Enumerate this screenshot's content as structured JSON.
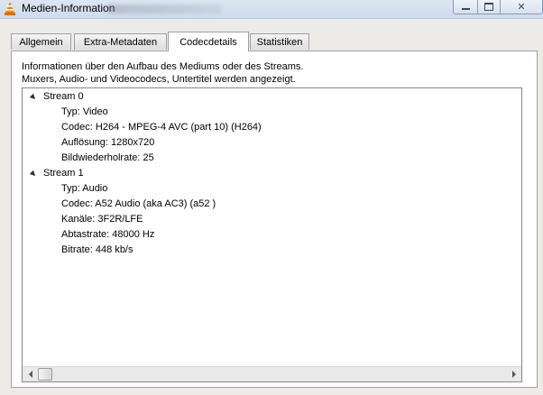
{
  "window": {
    "title": "Medien-Information",
    "icon": "vlc-cone-icon",
    "buttons": {
      "minimize": "minimize-icon",
      "maximize": "maximize-icon",
      "close": "close-icon",
      "close_glyph": "✕"
    }
  },
  "tabs": [
    {
      "label": "Allgemein",
      "active": false
    },
    {
      "label": "Extra-Metadaten",
      "active": false
    },
    {
      "label": "Codecdetails",
      "active": true
    },
    {
      "label": "Statistiken",
      "active": false
    }
  ],
  "description": {
    "line1": "Informationen über den Aufbau des Mediums oder des Streams.",
    "line2": "Muxers, Audio- und Videocodecs, Untertitel werden angezeigt."
  },
  "streams": [
    {
      "label": "Stream 0",
      "expanded": true,
      "items": [
        "Typ: Video",
        "Codec: H264 - MPEG-4 AVC (part 10) (H264)",
        "Auflösung: 1280x720",
        "Bildwiederholrate: 25"
      ]
    },
    {
      "label": "Stream 1",
      "expanded": true,
      "items": [
        "Typ: Audio",
        "Codec: A52 Audio (aka AC3) (a52 )",
        "Kanäle: 3F2R/LFE",
        "Abtastrate: 48000 Hz",
        "Bitrate: 448 kb/s"
      ]
    }
  ],
  "scrollbar": {
    "left_icon": "scroll-left-icon",
    "right_icon": "scroll-right-icon"
  },
  "colors": {
    "titlebar": "#dce6f2",
    "dialog_bg": "#ecebe8",
    "panel": "#ffffff",
    "vlc_orange": "#f08a00"
  }
}
